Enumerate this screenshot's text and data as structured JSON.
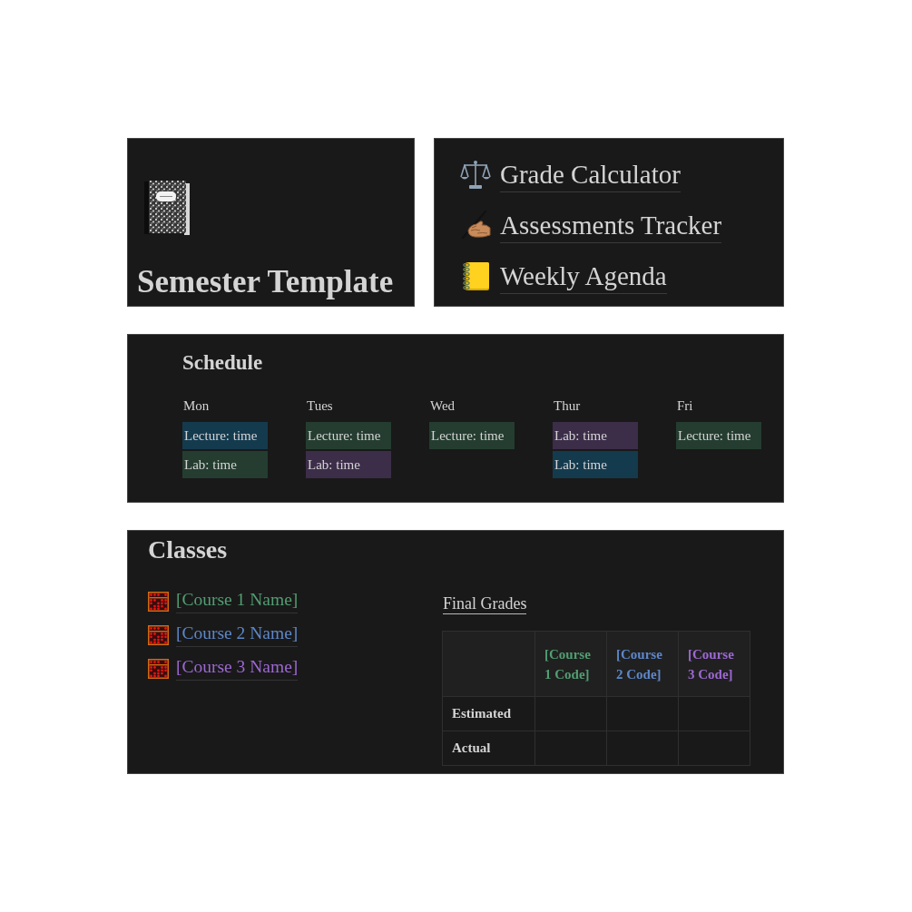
{
  "cover": {
    "title": "Semester Template"
  },
  "links": [
    {
      "label": "Grade Calculator"
    },
    {
      "label": "Assessments Tracker"
    },
    {
      "label": "Weekly Agenda"
    }
  ],
  "schedule": {
    "title": "Schedule",
    "days": [
      {
        "label": "Mon",
        "blocks": [
          {
            "text": "Lecture: time",
            "color": "#143a4e"
          },
          {
            "text": "Lab: time",
            "color": "#243d30"
          }
        ]
      },
      {
        "label": "Tues",
        "blocks": [
          {
            "text": "Lecture: time",
            "color": "#243d30"
          },
          {
            "text": "Lab: time",
            "color": "#3c2d49"
          }
        ]
      },
      {
        "label": "Wed",
        "blocks": [
          {
            "text": "Lecture: time",
            "color": "#243d30"
          }
        ]
      },
      {
        "label": "Thur",
        "blocks": [
          {
            "text": "Lab: time",
            "color": "#3c2d49"
          },
          {
            "text": "Lab: time",
            "color": "#143a4e"
          }
        ]
      },
      {
        "label": "Fri",
        "blocks": [
          {
            "text": "Lecture: time",
            "color": "#243d30"
          }
        ]
      }
    ]
  },
  "classes": {
    "title": "Classes",
    "courses": [
      {
        "name": "[Course 1 Name]",
        "color": "#529e72"
      },
      {
        "name": "[Course 2 Name]",
        "color": "#5e87c9"
      },
      {
        "name": "[Course 3 Name]",
        "color": "#9d68d3"
      }
    ],
    "grades": {
      "title": "Final Grades",
      "columns": [
        {
          "label": "[Course 1 Code]",
          "color": "#529e72"
        },
        {
          "label": "[Course 2 Code]",
          "color": "#5e87c9"
        },
        {
          "label": "[Course 3 Code]",
          "color": "#9d68d3"
        }
      ],
      "rows": [
        {
          "label": "Estimated"
        },
        {
          "label": "Actual"
        }
      ]
    }
  }
}
